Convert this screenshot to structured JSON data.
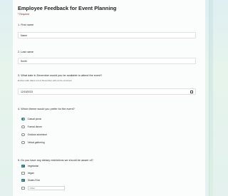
{
  "form": {
    "title": "Employee Feedback for Event Planning",
    "required_note": "* Required"
  },
  "questions": [
    {
      "title": "1. First name",
      "value": "Name"
    },
    {
      "title": "2. Last name",
      "value": "Smith"
    },
    {
      "title": "3. What date in December would you be available to attend the event?",
      "subtitle": "Entries with dates out of December will not be received.",
      "value": "12/15/2023",
      "icon": "calendar-icon"
    },
    {
      "title": "4. Which theme would you prefer for the event?",
      "options": [
        "Casual picnic",
        "Formal dinner",
        "Outdoor adventure",
        "Virtual gathering"
      ],
      "selected": "Casual picnic"
    },
    {
      "title": "5. Do you have any dietary restrictions we should be aware of?",
      "options": [
        "Vegetarian",
        "Vegan",
        "Gluten-Free",
        "Other"
      ],
      "checked": [
        "Vegetarian",
        "Gluten-Free"
      ],
      "other_placeholder": "Other"
    }
  ],
  "colors": {
    "accent": "#2f7a7a",
    "background": "#e4f1ee"
  }
}
